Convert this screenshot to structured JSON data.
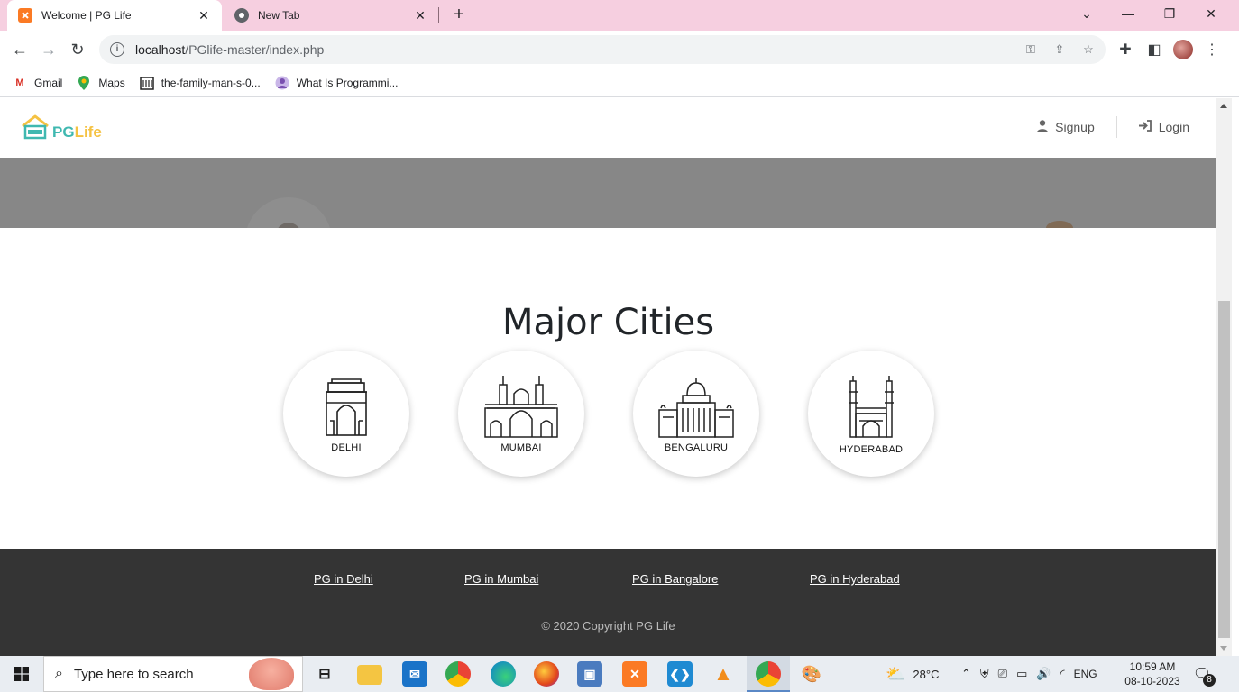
{
  "browser": {
    "tabs": [
      {
        "title": "Welcome | PG Life",
        "active": true
      },
      {
        "title": "New Tab",
        "active": false
      }
    ],
    "url_host": "localhost",
    "url_path": "/PGlife-master/index.php",
    "bookmarks": [
      {
        "label": "Gmail"
      },
      {
        "label": "Maps"
      },
      {
        "label": "the-family-man-s-0..."
      },
      {
        "label": "What Is Programmi..."
      }
    ]
  },
  "site": {
    "logo_pg": "PG",
    "logo_life": "Life",
    "nav": {
      "signup": "Signup",
      "login": "Login"
    },
    "section_title": "Major Cities",
    "cities": [
      {
        "name": "DELHI",
        "icon": "india-gate-icon"
      },
      {
        "name": "MUMBAI",
        "icon": "gateway-of-india-icon"
      },
      {
        "name": "BENGALURU",
        "icon": "vidhana-soudha-icon"
      },
      {
        "name": "HYDERABAD",
        "icon": "charminar-icon"
      }
    ],
    "footer_links": [
      "PG in Delhi",
      "PG in Mumbai",
      "PG in Bangalore",
      "PG in Hyderabad"
    ],
    "copyright": "© 2020 Copyright PG Life"
  },
  "taskbar": {
    "search_placeholder": "Type here to search",
    "weather": "28°C",
    "language": "ENG",
    "time": "10:59 AM",
    "date": "08-10-2023",
    "notification_count": "8"
  },
  "colors": {
    "tabstrip": "#f6cfe0",
    "brand_teal": "#3fb8b0",
    "brand_yellow": "#f5c242",
    "footer_bg": "#343434",
    "banner_bg": "#878787"
  }
}
